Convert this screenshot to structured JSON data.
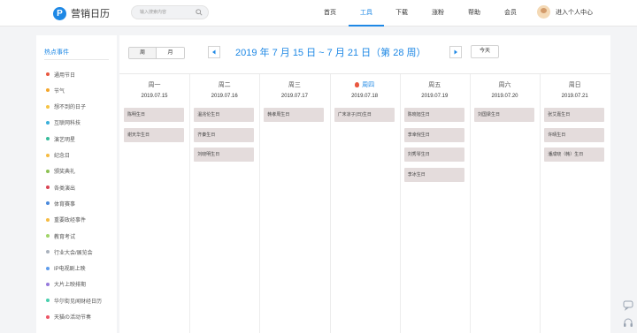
{
  "header": {
    "logo_glyph": "P",
    "logo_text": "营销日历",
    "search_placeholder": "输入搜索内容",
    "nav": [
      {
        "label": "首页",
        "active": false
      },
      {
        "label": "工具",
        "active": true
      },
      {
        "label": "下载",
        "active": false
      },
      {
        "label": "涨粉",
        "active": false
      },
      {
        "label": "帮助",
        "active": false
      },
      {
        "label": "会员",
        "active": false
      }
    ],
    "user_label": "进入个人中心",
    "accent": "#1e88e5"
  },
  "sidebar": {
    "title": "热点事件",
    "items": [
      {
        "label": "通用节日",
        "color": "#e9573f"
      },
      {
        "label": "节气",
        "color": "#f4a62a"
      },
      {
        "label": "想不到的日子",
        "color": "#f6c343"
      },
      {
        "label": "互联网科技",
        "color": "#3bafda"
      },
      {
        "label": "演艺明星",
        "color": "#37bc9b"
      },
      {
        "label": "纪念日",
        "color": "#f6bb42"
      },
      {
        "label": "颁奖典礼",
        "color": "#8cc152"
      },
      {
        "label": "各类演出",
        "color": "#da4453"
      },
      {
        "label": "体育赛事",
        "color": "#4a89dc"
      },
      {
        "label": "重要政经事件",
        "color": "#f6bb42"
      },
      {
        "label": "教育考试",
        "color": "#a0d468"
      },
      {
        "label": "行业大会/展览会",
        "color": "#aab2bd"
      },
      {
        "label": "IP电视剧上映",
        "color": "#5d9cec"
      },
      {
        "label": "大片上映排期",
        "color": "#967adc"
      },
      {
        "label": "华尔街见闻财经日历",
        "color": "#48cfad"
      },
      {
        "label": "天猫の活动节奏",
        "color": "#ed5565"
      }
    ]
  },
  "calendar": {
    "view_week": "周",
    "view_month": "月",
    "range_label": "2019 年 7 月 15 日 ~ 7 月 21 日（第 28 周）",
    "today_label": "今天",
    "days": [
      {
        "name": "周一",
        "date": "2019.07.15",
        "today": false,
        "events": [
          "陈明生日",
          "谢天华生日"
        ]
      },
      {
        "name": "周二",
        "date": "2019.07.16",
        "today": false,
        "events": [
          "温兆伦生日",
          "齐秦生日",
          "刘晓明生日"
        ]
      },
      {
        "name": "周三",
        "date": "2019.07.17",
        "today": false,
        "events": [
          "韩孝周生日"
        ]
      },
      {
        "name": "周四",
        "date": "2019.07.18",
        "today": true,
        "events": [
          "广末凉子(日)生日"
        ]
      },
      {
        "name": "周五",
        "date": "2019.07.19",
        "today": false,
        "events": [
          "陈晓旭生日",
          "李幸倪生日",
          "刘秀琴生日",
          "李冰生日"
        ]
      },
      {
        "name": "周六",
        "date": "2019.07.20",
        "today": false,
        "events": [
          "刘国梁生日"
        ]
      },
      {
        "name": "周日",
        "date": "2019.07.21",
        "today": false,
        "events": [
          "张艾嘉生日",
          "许晴生日",
          "潘成晓（韩）生日"
        ]
      }
    ],
    "event_color": "#e4dcdc"
  }
}
